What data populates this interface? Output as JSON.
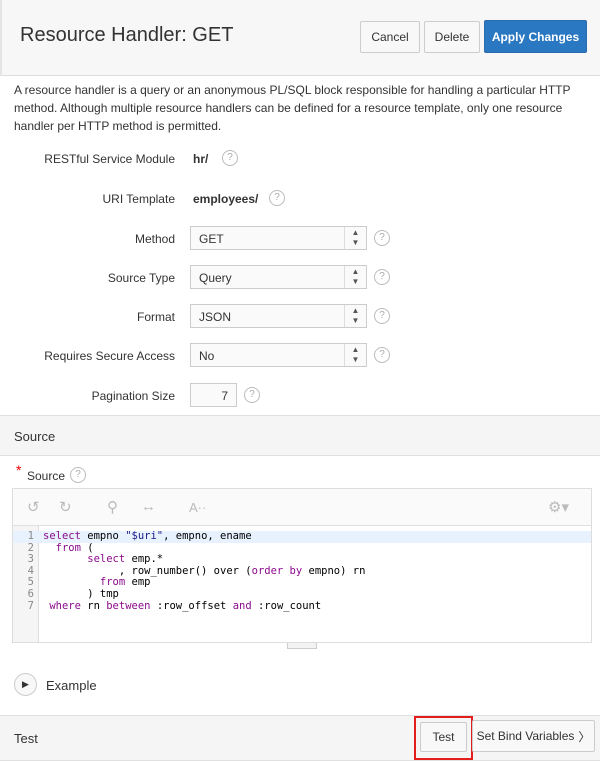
{
  "header": {
    "title": "Resource Handler: GET",
    "cancel": "Cancel",
    "delete": "Delete",
    "apply": "Apply Changes"
  },
  "description": "A resource handler is a query or an anonymous PL/SQL block responsible for handling a particular HTTP method. Although multiple resource handlers can be defined for a resource template, only one resource handler per HTTP method is permitted.",
  "form": {
    "module_label": "RESTful Service Module",
    "module_value": "hr/",
    "uri_label": "URI Template",
    "uri_value": "employees/",
    "method_label": "Method",
    "method_value": "GET",
    "source_type_label": "Source Type",
    "source_type_value": "Query",
    "format_label": "Format",
    "format_value": "JSON",
    "secure_label": "Requires Secure Access",
    "secure_value": "No",
    "pagination_label": "Pagination Size",
    "pagination_value": "7",
    "help": "?"
  },
  "source": {
    "region_title": "Source",
    "required_mark": "*",
    "label": "Source",
    "code": [
      [
        [
          "select",
          "kw"
        ],
        [
          " empno ",
          ""
        ],
        [
          "\"$uri\"",
          "str"
        ],
        [
          ", empno, ename",
          ""
        ]
      ],
      [
        [
          "  ",
          ""
        ],
        [
          "from",
          "kw"
        ],
        [
          " (",
          ""
        ]
      ],
      [
        [
          "       ",
          ""
        ],
        [
          "select",
          "kw"
        ],
        [
          " emp.*",
          ""
        ]
      ],
      [
        [
          "            , row_number() over (",
          ""
        ],
        [
          "order by",
          "kw"
        ],
        [
          " empno) rn",
          ""
        ]
      ],
      [
        [
          "         ",
          ""
        ],
        [
          "from",
          "kw"
        ],
        [
          " emp",
          ""
        ]
      ],
      [
        [
          "       ) tmp",
          ""
        ]
      ],
      [
        [
          " ",
          ""
        ],
        [
          "where",
          "kw"
        ],
        [
          " rn ",
          ""
        ],
        [
          "between",
          "kw"
        ],
        [
          " :row_offset ",
          ""
        ],
        [
          "and",
          "kw"
        ],
        [
          " :row_count",
          ""
        ]
      ]
    ]
  },
  "example": {
    "label": "Example"
  },
  "test": {
    "region_title": "Test",
    "test_button": "Test",
    "bind_button": "Set Bind Variables"
  },
  "colors": {
    "primary": "#2a78c2",
    "highlight": "#e31c1c"
  }
}
